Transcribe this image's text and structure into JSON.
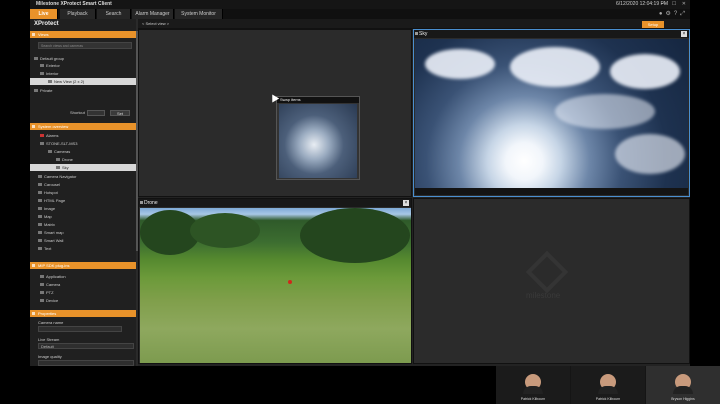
{
  "window": {
    "title": "Milestone XProtect Smart Client",
    "datetime": "6/12/2020 12:04:19 PM"
  },
  "tabs": [
    {
      "label": "Live"
    },
    {
      "label": "Playback"
    },
    {
      "label": "Search"
    },
    {
      "label": "Alarm Manager"
    },
    {
      "label": "System Monitor"
    }
  ],
  "sidebar": {
    "title": "XProtect",
    "views": {
      "header": "Views",
      "search_placeholder": "Search views and cameras",
      "items": [
        {
          "label": "Default group"
        },
        {
          "label": "Exterior"
        },
        {
          "label": "Interior"
        },
        {
          "label": "New View (2 x 2)"
        },
        {
          "label": "Private"
        }
      ]
    },
    "shortcut": {
      "label": "Shortcut",
      "button": "Set"
    },
    "system_overview": {
      "header": "System overview",
      "items": [
        {
          "label": "Alarms"
        },
        {
          "label": "STONE-SLT-MS3"
        },
        {
          "label": "Cameras"
        },
        {
          "label": "Drone"
        },
        {
          "label": "Sky"
        },
        {
          "label": "Camera Navigator"
        },
        {
          "label": "Carousel"
        },
        {
          "label": "Hotspot"
        },
        {
          "label": "HTML Page"
        },
        {
          "label": "Image"
        },
        {
          "label": "Map"
        },
        {
          "label": "Matrix"
        },
        {
          "label": "Smart map"
        },
        {
          "label": "Smart Wall"
        },
        {
          "label": "Text"
        }
      ]
    },
    "mip": {
      "header": "MIP SDK plug-ins",
      "items": [
        {
          "label": "Application"
        },
        {
          "label": "Camera"
        },
        {
          "label": "PTZ"
        },
        {
          "label": "Device"
        }
      ]
    },
    "properties": {
      "header": "Properties",
      "camera_name_label": "Camera name",
      "live_stream_label": "Live Stream",
      "live_stream_value": "Default",
      "image_quality_label": "Image quality"
    }
  },
  "toolbar": {
    "select_view": "< Select view >",
    "setup": "Setup"
  },
  "panes": {
    "sky": "Sky",
    "drone": "Drone",
    "swap": "Swap items",
    "watermark": "milestone"
  },
  "participants": [
    {
      "name": "Patrick Kilbourn"
    },
    {
      "name": "Patrick Kilbourn"
    },
    {
      "name": "Bryson Higgins"
    }
  ]
}
